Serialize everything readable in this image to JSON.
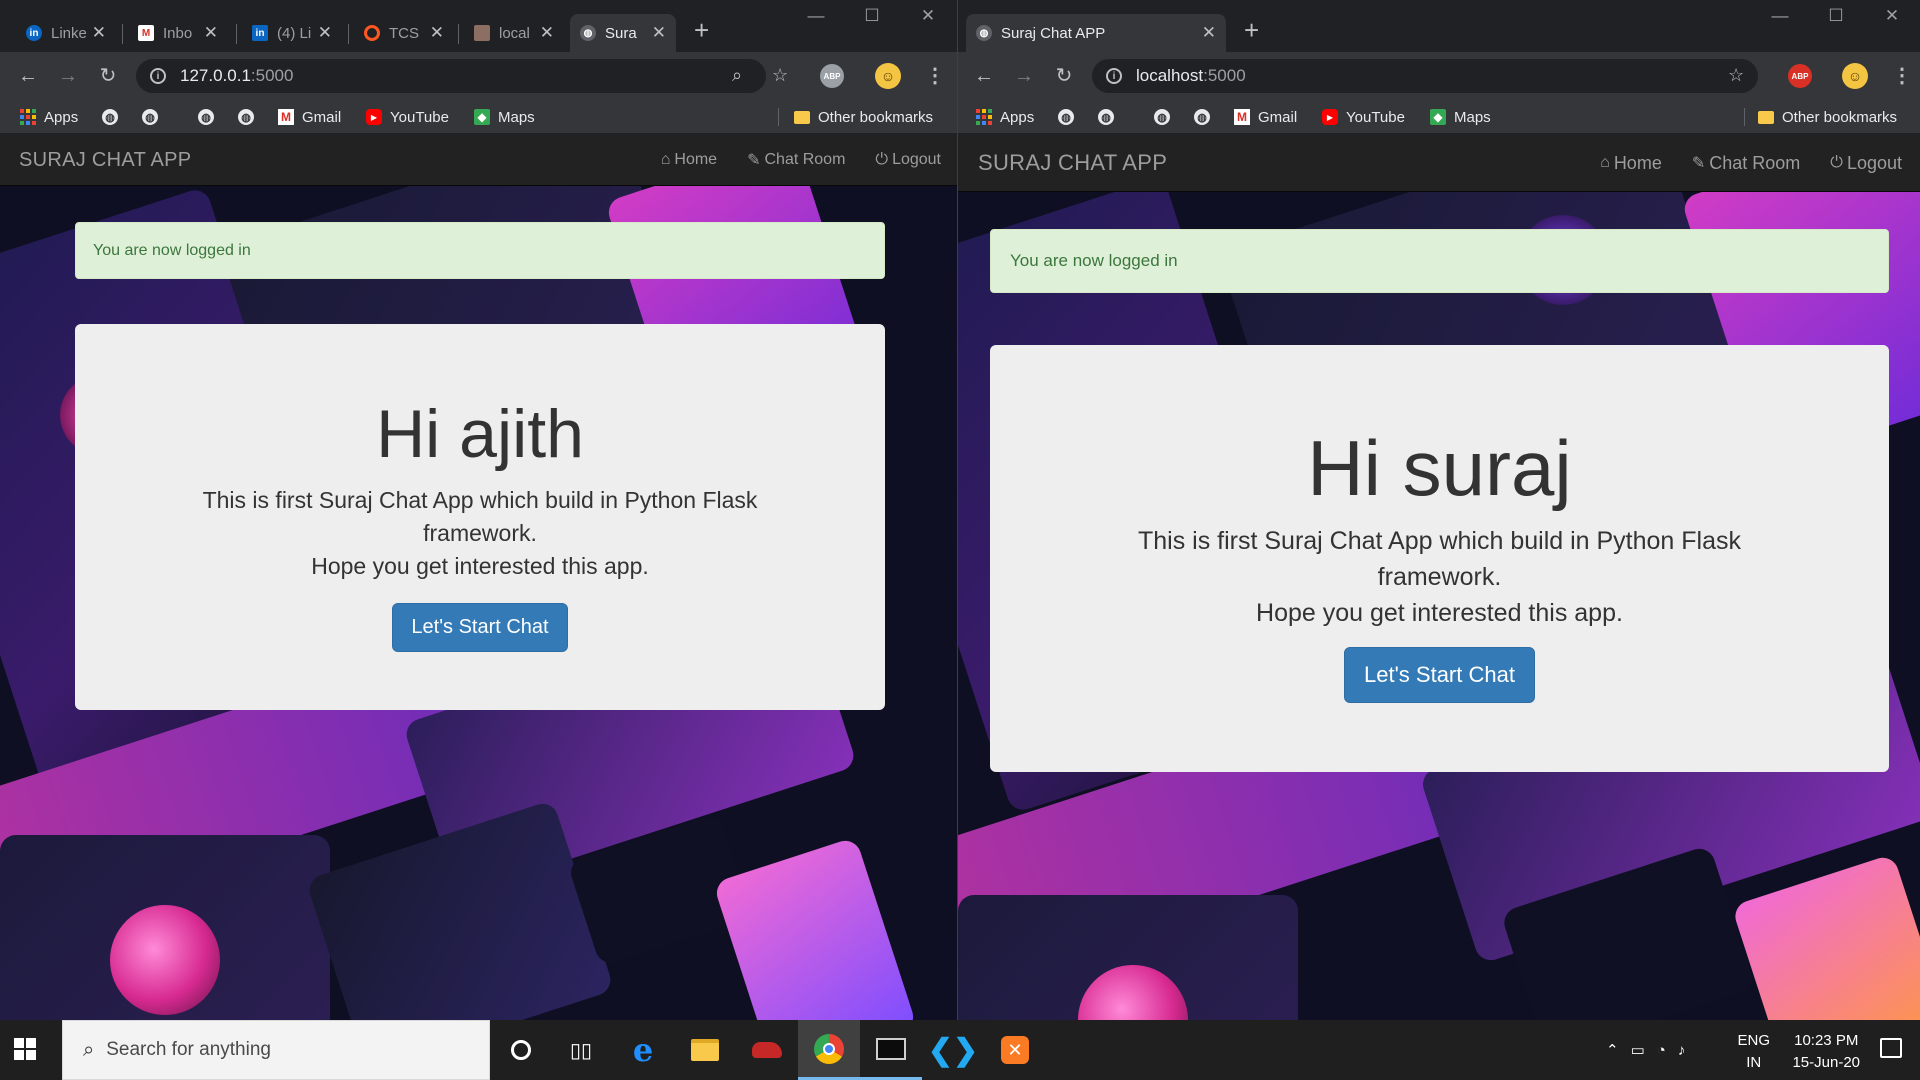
{
  "left_window": {
    "tabs": [
      {
        "title": "Linke",
        "favicon": "linkedin-icon",
        "color": "#0a66c2",
        "active": false
      },
      {
        "title": "Inbo",
        "favicon": "gmail-icon",
        "color": "#d93025",
        "active": false
      },
      {
        "title": "(4) Li",
        "favicon": "linkedin-icon",
        "color": "#0a66c2",
        "active": false
      },
      {
        "title": "TCS",
        "favicon": "tcs-icon",
        "color": "#ff5722",
        "active": false
      },
      {
        "title": "local",
        "favicon": "image-icon",
        "color": "#8d6e63",
        "active": false
      },
      {
        "title": "Sura",
        "favicon": "globe-icon",
        "color": "#9aa0a6",
        "active": true
      }
    ],
    "url_host": "127.0.0.1",
    "url_port": ":5000",
    "page": {
      "brand": "SURAJ CHAT APP",
      "nav": {
        "home": "Home",
        "chat_room": "Chat Room",
        "logout": "Logout"
      },
      "alert": "You are now logged in",
      "greeting": "Hi ajith",
      "line1": "This is first Suraj Chat App which build in Python Flask framework.",
      "line2": "Hope you get interested this app.",
      "cta": "Let's Start Chat"
    }
  },
  "right_window": {
    "tabs": [
      {
        "title": "Suraj Chat APP",
        "favicon": "globe-icon",
        "color": "#9aa0a6",
        "active": true
      }
    ],
    "url_host": "localhost",
    "url_port": ":5000",
    "page": {
      "brand": "SURAJ CHAT APP",
      "nav": {
        "home": "Home",
        "chat_room": "Chat Room",
        "logout": "Logout"
      },
      "alert": "You are now logged in",
      "greeting": "Hi suraj",
      "line1": "This is first Suraj Chat App which build in Python Flask framework.",
      "line2": "Hope you get interested this app.",
      "cta": "Let's Start Chat"
    }
  },
  "bookmarks": {
    "apps": "Apps",
    "gmail": "Gmail",
    "youtube": "YouTube",
    "maps": "Maps",
    "other": "Other bookmarks"
  },
  "extensions": {
    "abp": "ABP"
  },
  "taskbar": {
    "search_placeholder": "Search for anything",
    "lang_line1": "ENG",
    "lang_line2": "IN",
    "time": "10:23 PM",
    "date": "15-Jun-20"
  },
  "colors": {
    "navbar": "#222222",
    "alert_bg": "#dff0d8",
    "alert_text": "#3c763d",
    "jumbotron": "#eeeeee",
    "primary": "#337ab7"
  }
}
